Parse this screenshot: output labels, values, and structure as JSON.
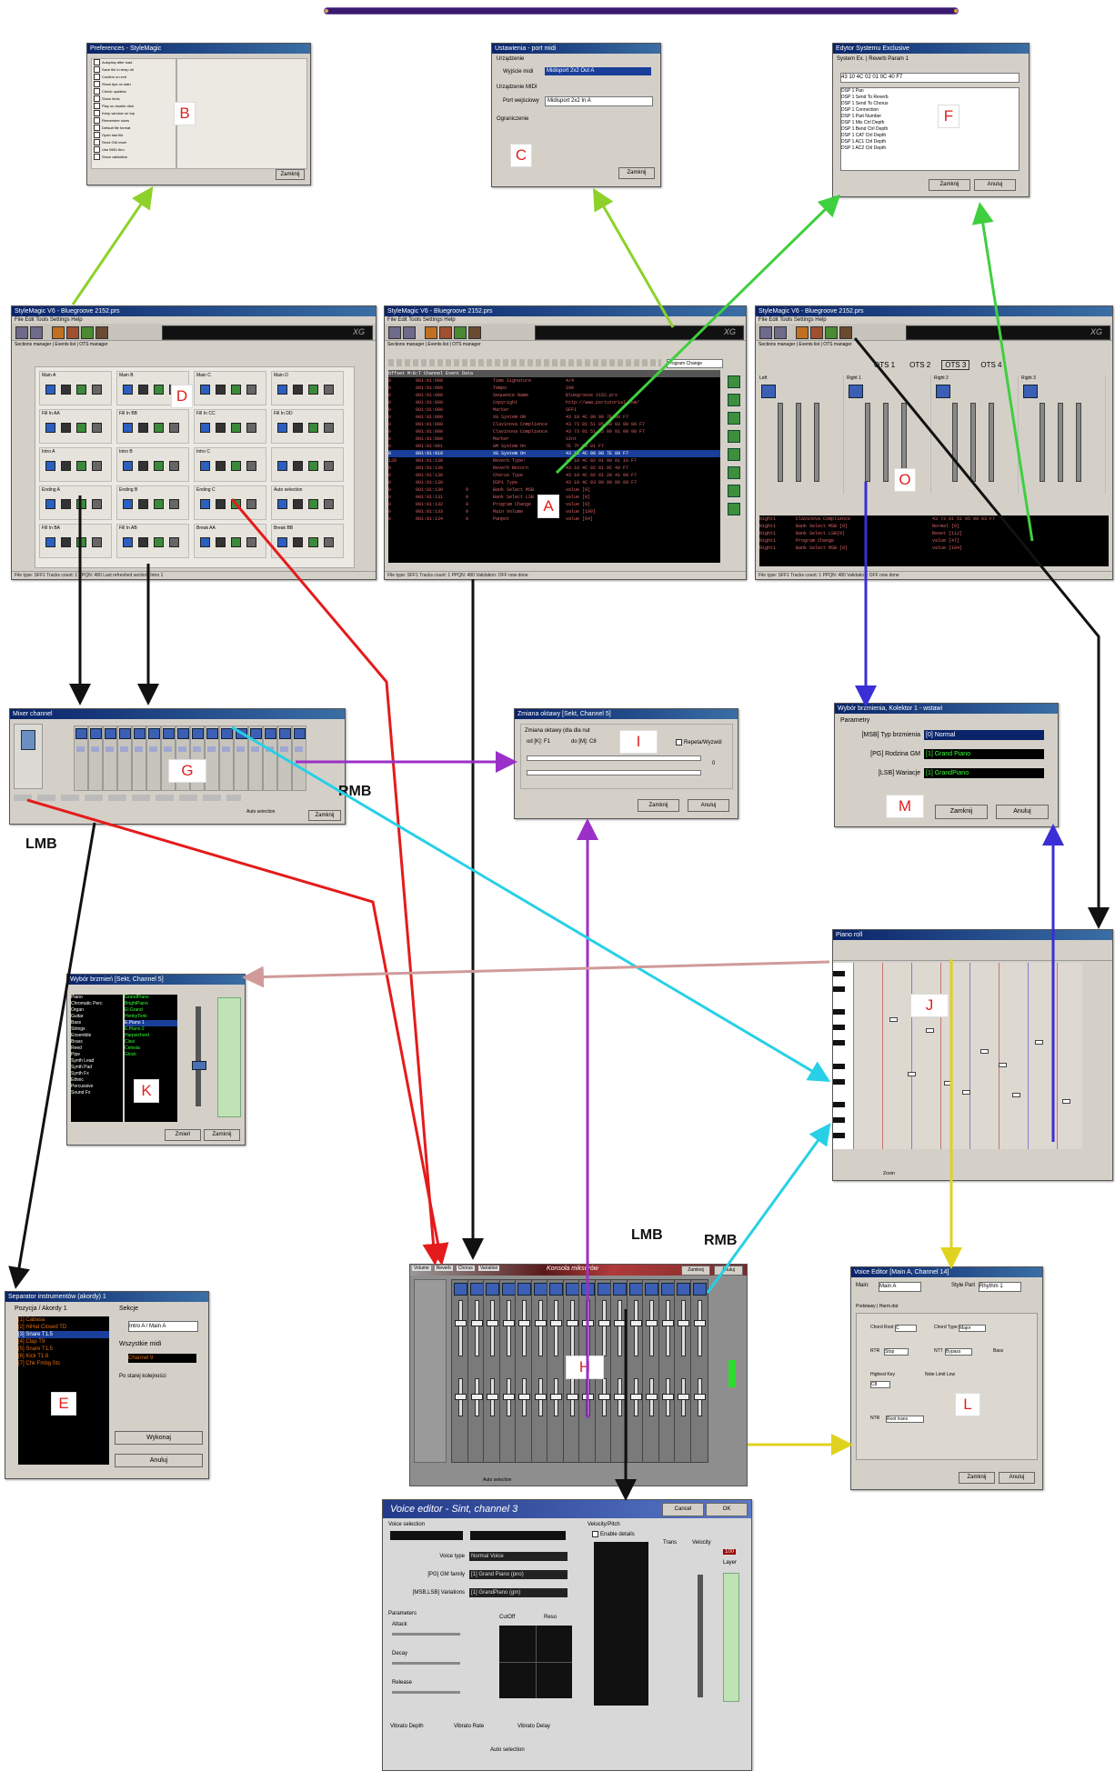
{
  "labels": {
    "A": "A",
    "B": "B",
    "C": "C",
    "D": "D",
    "E": "E",
    "F": "F",
    "G": "G",
    "H": "H",
    "I": "I",
    "J": "J",
    "K": "K",
    "L": "L",
    "M": "M",
    "O": "O"
  },
  "mouse_labels": {
    "lmb_left": "LMB",
    "rmb_g": "RMB",
    "lmb_h": "LMB",
    "rmb_h": "RMB"
  },
  "colors": {
    "arrow_black": "#111111",
    "arrow_red": "#e41b1b",
    "arrow_green": "#8ed12a",
    "arrow_lime": "#3fcf3f",
    "arrow_cyan": "#27d0e6",
    "arrow_purple": "#9b30c8",
    "arrow_blue": "#3a2ed6",
    "arrow_pink": "#d09a9a",
    "arrow_yellow": "#e0d21f",
    "label_text": "#e02020"
  },
  "main_windows": {
    "left_title": "StyleMagic V6 - Bluegroove 2152.prs",
    "center_title": "StyleMagic V6 - Bluegroove 2152.prs",
    "right_title": "StyleMagic V6 - Bluegroove 2152.prs",
    "menu": "File   Edit   Tools   Settings   Help",
    "xg": "XG",
    "left_tabs": "Sections manager | Events list | OTS manager",
    "center_tabs": "Sections manager | Events list | OTS manager",
    "right_tabs": "Sections manager | Events list | OTS manager",
    "status_left": "File type: SFF1   Tracks count: 1   PPQN: 480   Last refreshed section: Intro 1",
    "status_center": "File type: SFF1   Tracks count: 1   PPQN: 480   Validation: OFF now done",
    "status_right": "File type: SFF1   Tracks count: 1   PPQN: 480   Validation: OFF now done",
    "sections": [
      "Main A",
      "Main B",
      "Main C",
      "Main D",
      "Fill In AA",
      "Fill In BB",
      "Fill In CC",
      "Fill In DD",
      "Intro A",
      "Intro B",
      "Intro C",
      "",
      "Ending A",
      "Ending B",
      "Ending C",
      "Auto selection",
      "Fill In BA",
      "Fill In AB",
      "Break AA",
      "Break BB"
    ],
    "event_headers": [
      "Offset",
      "M:B:T",
      "Channel",
      "Event",
      "Data"
    ],
    "event_rows": [
      [
        "0",
        "001:01:000",
        "",
        "Time Signature",
        "4/4"
      ],
      [
        "0",
        "001:01:000",
        "",
        "Tempo",
        "100"
      ],
      [
        "0",
        "001:01:000",
        "",
        "Sequence Name",
        "Bluegroove 2152.prs"
      ],
      [
        "0",
        "001:01:000",
        "",
        "Copyright",
        "http://www.psrtutorial.com/"
      ],
      [
        "0",
        "001:01:000",
        "",
        "Marker",
        "SFF1"
      ],
      [
        "0",
        "001:01:000",
        "",
        "XG System ON",
        "43 10 4C 00 00 7E 00 F7"
      ],
      [
        "0",
        "001:01:000",
        "",
        "Clavinova Complience",
        "43 73 01 51 05 00 03 00 00 F7"
      ],
      [
        "0",
        "001:01:000",
        "",
        "Clavinova Complience",
        "43 73 01 51 05 00 01 00 00 F7"
      ],
      [
        "0",
        "001:01:000",
        "",
        "Marker",
        "SInt"
      ],
      [
        "0",
        "001:01:001",
        "",
        "GM System On",
        "7E 7F 09 01 F7"
      ],
      [
        "0",
        "001:01:010",
        "",
        "XG System On",
        "43 10 4C 00 00 7E 00 F7"
      ],
      [
        "120",
        "001:01:130",
        "",
        "Reverb Type:",
        "43 10 4C 02 01 00 01 10 F7"
      ],
      [
        "0",
        "001:01:130",
        "",
        "Reverb Return",
        "43 10 4C 02 01 0C 40 F7"
      ],
      [
        "0",
        "001:01:130",
        "",
        "Chorus Type",
        "43 10 4C 02 01 20 41 00 F7"
      ],
      [
        "0",
        "001:01:130",
        "",
        "DSP1 Type",
        "43 10 4C 03 00 00 00 00 F7"
      ],
      [
        "0",
        "001:01:130",
        "9",
        "Bank Select MSB",
        "value [0]"
      ],
      [
        "0",
        "001:01:131",
        "9",
        "Bank Select LSB",
        "value [0]"
      ],
      [
        "0",
        "001:01:132",
        "9",
        "Program Change",
        "value [0]"
      ],
      [
        "0",
        "001:01:133",
        "9",
        "Main Volume",
        "value [100]"
      ],
      [
        "0",
        "001:01:134",
        "9",
        "Panpot",
        "value [64]"
      ]
    ],
    "event_filter": "Program Change",
    "ots_tabs": [
      "OTS 1",
      "OTS 2",
      "OTS 3",
      "OTS 4"
    ],
    "ots_parts": [
      "Left",
      "Right 1",
      "Right 2",
      "Right 3"
    ],
    "ots_events": [
      [
        "Right1",
        "Clavinova Complience",
        "43 73 01 51 05 00 03 F7"
      ],
      [
        "Right1",
        "Bank Select MSB [0]",
        "Normal [0]"
      ],
      [
        "Right1",
        "Bank Select LSB[0]",
        "Reset [112]"
      ],
      [
        "Right1",
        "Program Change",
        "value [47]"
      ],
      [
        "Right1",
        "Bank Select MSB [0]",
        "value [104]"
      ]
    ]
  },
  "dlg_b": {
    "title": "Preferences - StyleMagic",
    "items": [
      "Autoplay after load",
      "Save file in temp dir",
      "Confirm on exit",
      "Show tips on start",
      "Check updates",
      "Show hints",
      "Play on double click",
      "Keep window on top",
      "Remember sizes",
      "Default file format",
      "Open last file",
      "Send GM reset",
      "Use MIDI thru",
      "Show validation"
    ],
    "ok": "Zamknij"
  },
  "dlg_c": {
    "title": "Ustawienia - port midi",
    "group1": "Urządzenie",
    "out_label": "Wyjście midi",
    "out_value": "Midisport 2x2 Out A",
    "group2": "Urządzenie MIDI",
    "in_label": "Port wejściowy",
    "in_value": "Midisport 2x2 In A",
    "group3": "Ograniczenie",
    "ok": "Zamknij"
  },
  "dlg_f": {
    "title": "Edytor Systemu Exclusive",
    "tab1": "System Ex.",
    "tab2": "Reverb Param 1",
    "hex": "43 10 4C 02 01 0C 40 F7",
    "items": [
      "DSP 1 Pan",
      "DSP 1 Send To Reverb",
      "DSP 1 Send To Chorus",
      "DSP 1 Connection",
      "DSP 1 Part Number",
      "DSP 1 Mix Ctrl Depth",
      "DSP 1 Bend Ctrl Depth",
      "DSP 1 CAT Ctrl Depth",
      "DSP 1 AC1 Ctrl Depth",
      "DSP 1 AC2 Ctrl Depth"
    ],
    "ok": "Zamknij",
    "cancel": "Anuluj"
  },
  "dlg_g": {
    "title": "Mixer channel",
    "bottom": "Auto selection",
    "close": "Zamknij"
  },
  "dlg_i": {
    "title": "Zmiana oktawy [Sekt, Channel 5]",
    "caption": "Zmiana oktawy (dla dla nut",
    "from": "od [K]: F1",
    "to": "do [M]: C8",
    "repeat": "Repeta/Wyzwól",
    "ok": "Zamknij",
    "cancel": "Anuluj",
    "value": "0"
  },
  "dlg_m": {
    "title": "Wybór brzmienia, Kolektor 1 - wstawi",
    "group": "Parametry",
    "r1_label": "[MSB] Typ brzmienia",
    "r1_value": "[0] Normal",
    "r2_label": "[PG] Rodzina GM",
    "r2_value": "[1] Grand Piano",
    "r3_label": "[LSB] Wariacje",
    "r3_value": "[1] GrandPiano",
    "ok": "Zamknij",
    "cancel": "Anuluj"
  },
  "dlg_j": {
    "title": "Piano roll",
    "zoom": "Zoom"
  },
  "dlg_k": {
    "title": "Wybór brzmień [Sekt, Channel 5]",
    "left_items": [
      "Piano",
      "Chromatic Perc",
      "Organ",
      "Guitar",
      "Bass",
      "Strings",
      "Ensemble",
      "Brass",
      "Reed",
      "Pipe",
      "Synth Lead",
      "Synth Pad",
      "Synth Fx",
      "Ethnic",
      "Percussive",
      "Sound Fx"
    ],
    "right_items": [
      "GrandPiano",
      "BrightPiano",
      "El.Grand",
      "HonkyTonk",
      "E.Piano 1",
      "E.Piano 2",
      "Harpsichord",
      "Clavi",
      "Celesta",
      "Glock"
    ],
    "ok": "Zmień",
    "cancel": "Zamknij"
  },
  "dlg_e": {
    "title": "Separator instrumentów (akordy) 1",
    "list_label": "Pozycja / Akordy 1",
    "items": [
      "[1] Cabasa",
      "[2] HiHat Closed TD",
      "[3] Snare T1.5",
      "[4] Clap T9",
      "[5] Snare T1.5",
      "[6] Kick T1.8",
      "[7] Chk Fmbg Stc"
    ],
    "group_right": "Sekcje",
    "combo": "Intro A / Main A",
    "lbl2": "Wszystkie midi",
    "combo2": "Channel 9",
    "lbl3": "Po starej kolejności",
    "ok": "Wykonaj",
    "cancel": "Anuluj"
  },
  "dlg_h": {
    "title": "Konsola mikserów",
    "tabs": [
      "Volume",
      "Reverb",
      "Chorus",
      "Variation"
    ],
    "ok": "Zamknij",
    "cancel": "Anuluj",
    "label": "Auto selection"
  },
  "dlg_l": {
    "title": "Voice Editor [Main A, Channel 14]",
    "main_label": "Main:",
    "main_value": "Main A",
    "style_label": "Style Part",
    "style_value": "Rhythm 1",
    "tab1": "Podstawy",
    "tab2": "Harm.dat",
    "r1": "Chord Root",
    "r1v": "C",
    "r2": "Chord Type",
    "r2v": "Major",
    "r3": "RTR",
    "r3v": "Stop",
    "r4": "NTT",
    "r4v": "Bypass",
    "r5": "Bass",
    "r6": "Highest Key",
    "r6v": "C8",
    "r7": "Note Limit Low",
    "r8": "NTR",
    "r8v": "Root trans",
    "ok": "Zamknij",
    "cancel": "Anuluj"
  },
  "dlg_voice": {
    "title": "Voice editor - Sint, channel 3",
    "cancel": "Cancel",
    "ok": "OK",
    "voice_sel": "Voice selection",
    "voice_type": "Voice type",
    "voice_type_v": "Normal Voice",
    "pg": "[PG] GM family",
    "pg_v": "[1] Grand Piano (pno)",
    "msb": "[MSB,LSB] Variations",
    "msb_v": "[1] GrandPiano (gm)",
    "params": "Parameters",
    "attack": "Attack",
    "decay": "Decay",
    "release": "Release",
    "cutoff": "CutOff",
    "reso": "Reso",
    "vdepth": "Vibrato Depth",
    "vrate": "Vibrato Rate",
    "vdelay": "Vibrato Delay",
    "vel_pitch": "Velocity/Pitch",
    "enable": "Enable details",
    "trans": "Trans",
    "velocity": "Velocity",
    "vel_value": "100",
    "layer": "Layer",
    "auto": "Auto selection"
  }
}
